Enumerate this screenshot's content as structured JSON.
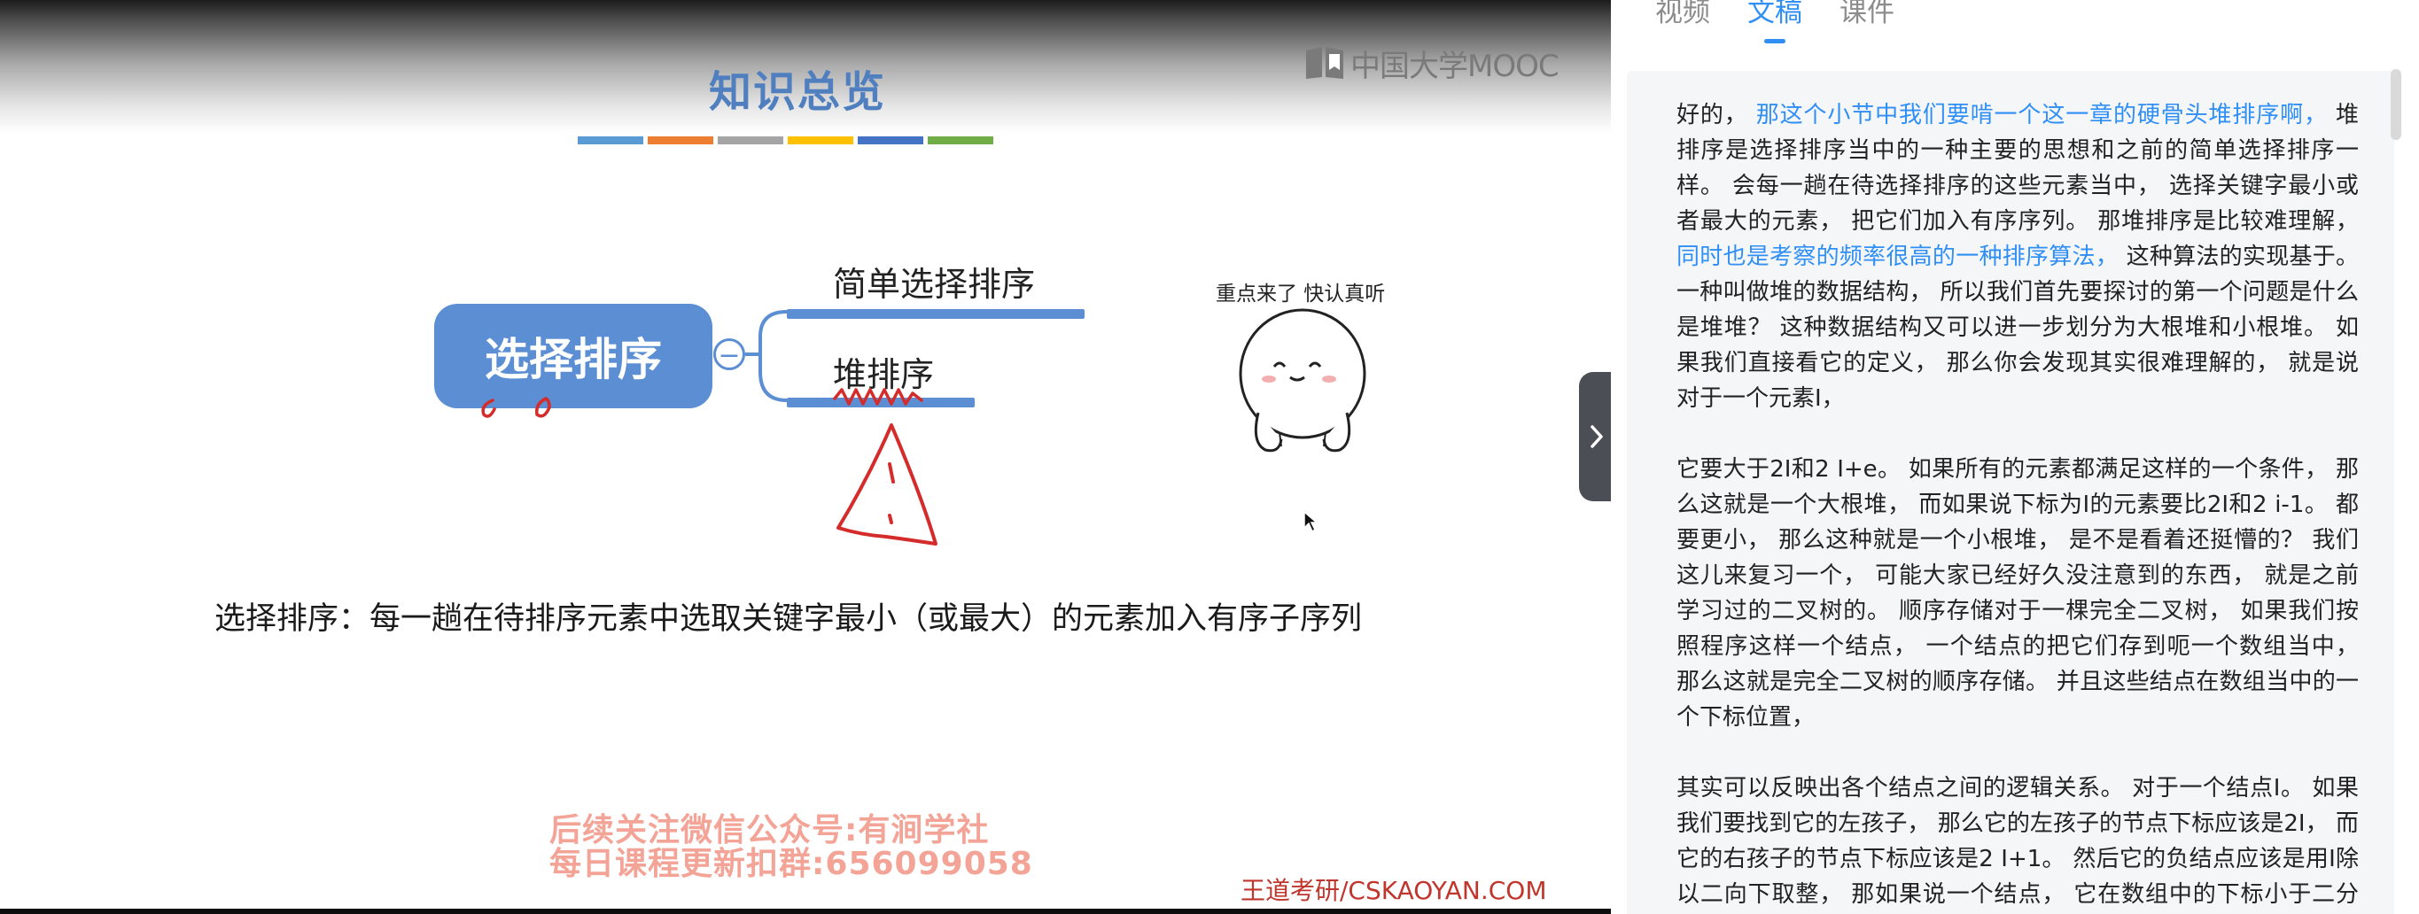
{
  "video": {
    "slide_title": "知识总览",
    "brand_logo_text": "中国大学MOOC",
    "color_bars": [
      "#5b9bd5",
      "#ed7d31",
      "#a5a5a5",
      "#ffc000",
      "#4472c4",
      "#70ad47"
    ],
    "mindmap": {
      "root": "选择排序",
      "collapse_symbol": "−",
      "branches": [
        "简单选择排序",
        "堆排序"
      ]
    },
    "sticker_caption": "重点来了 快认真听",
    "definition": "选择排序：每一趟在待排序元素中选取关键字最小（或最大）的元素加入有序子序列",
    "watermark_line1": "后续关注微信公众号:有涧学社",
    "watermark_line2": "每日课程更新扣群:656099058",
    "source_label": "王道考研/CSKAOYAN.COM"
  },
  "panel": {
    "tabs": [
      {
        "label": "视频",
        "active": false
      },
      {
        "label": "文稿",
        "active": true
      },
      {
        "label": "课件",
        "active": false
      }
    ],
    "expand_icon": "chevron-right-icon",
    "accent_color": "#2f8ff5",
    "paragraphs": [
      [
        {
          "text": "好的， ",
          "highlight": false
        },
        {
          "text": "那这个小节中我们要啃一个这一章的硬骨头堆排序啊， ",
          "highlight": true
        },
        {
          "text": "堆排序是选择排序当中的一种主要的思想和之前的简单选择排序一样。 会每一趟在待选择排序的这些元素当中， 选择关键字最小或者最大的元素， 把它们加入有序序列。 那堆排序是比较难理解， ",
          "highlight": false
        },
        {
          "text": "同时也是考察的频率很高的一种排序算法， ",
          "highlight": true
        },
        {
          "text": "这种算法的实现基于。 一种叫做堆的数据结构， 所以我们首先要探讨的第一个问题是什么是堆堆？ 这种数据结构又可以进一步划分为大根堆和小根堆。 如果我们直接看它的定义， 那么你会发现其实很难理解的， 就是说对于一个元素I，",
          "highlight": false
        }
      ],
      [
        {
          "text": "它要大于2I和2 I+e。 如果所有的元素都满足这样的一个条件， 那么这就是一个大根堆， 而如果说下标为I的元素要比2I和2 i-1。 都要更小， 那么这种就是一个小根堆， 是不是看着还挺懵的？ 我们这儿来复习一个， 可能大家已经好久没注意到的东西， 就是之前学习过的二叉树的。 顺序存储对于一棵完全二叉树， 如果我们按照程序这样一个结点， 一个结点的把它们存到呃一个数组当中， 那么这就是完全二叉树的顺序存储。 并且这些结点在数组当中的一个下标位置，",
          "highlight": false
        }
      ],
      [
        {
          "text": "其实可以反映出各个结点之间的逻辑关系。 对于一个结点I。 如果我们要找到它的左孩子， 那么它的左孩子的节点下标应该是2I， 而它的右孩子的节点下标应该是2 I+1。 然后它的负结点应该是用I除以二向下取整， 那如果说一个结点， 它在数组中的下标小于二分之n，",
          "highlight": false
        }
      ]
    ]
  }
}
